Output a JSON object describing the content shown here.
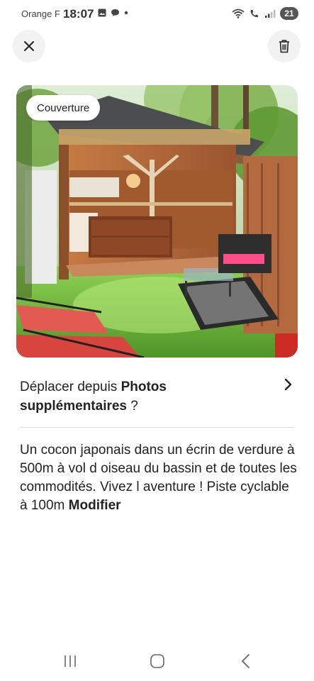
{
  "status_bar": {
    "carrier": "Orange F",
    "time": "18:07",
    "battery": "21",
    "icons": [
      "image-icon",
      "chat-bubble-icon",
      "dot-icon",
      "wifi-icon",
      "call-icon",
      "signal-icon"
    ]
  },
  "header": {
    "close_icon": "close-icon",
    "delete_icon": "trash-icon"
  },
  "photo": {
    "badge_label": "Couverture",
    "description": "garden cabin with terrace and red lounge chairs"
  },
  "move_prompt": {
    "prefix": "Déplacer depuis ",
    "bold": "Photos supplémentaires",
    "suffix": " ?"
  },
  "caption": {
    "text": "Un cocon japonais dans un écrin de verdure à 500m à vol d oiseau du bassin et de toutes les commodités. Vivez l aventure ! Piste cyclable à 100m ",
    "edit_label": "Modifier"
  },
  "nav": {
    "icons": [
      "recents-icon",
      "home-icon",
      "back-icon"
    ]
  },
  "colors": {
    "accent_red": "#e04848",
    "grass": "#6fae3a",
    "wood": "#b86b3a"
  }
}
